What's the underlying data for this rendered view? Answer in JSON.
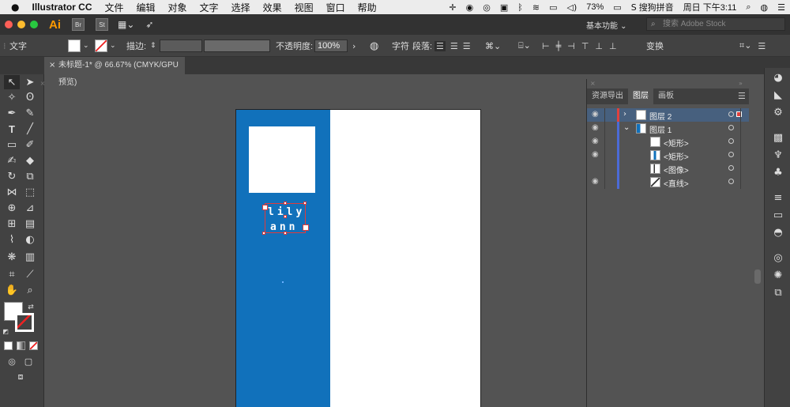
{
  "menubar": {
    "apple": "",
    "app_name": "Illustrator CC",
    "items": [
      "文件",
      "编辑",
      "对象",
      "文字",
      "选择",
      "效果",
      "视图",
      "窗口",
      "帮助"
    ],
    "battery": "73%",
    "input_method": "搜狗拼音",
    "clock": "周日 下午3:11"
  },
  "appbar": {
    "logo": "Ai",
    "bridge": "Br",
    "stock_app": "St",
    "workspace": "基本功能",
    "search_placeholder": "搜索 Adobe Stock"
  },
  "control": {
    "tool_label": "文字",
    "stroke_label": "描边:",
    "opacity_label": "不透明度:",
    "opacity_value": "100%",
    "char_label": "字符",
    "para_label": "段落:",
    "transform_label": "变换"
  },
  "document": {
    "tab_title": "未标题-1* @ 66.67% (CMYK/GPU 预览)"
  },
  "canvas": {
    "text_line1": "lily",
    "text_line2": "ann",
    "colors": {
      "blue": "#1171bb",
      "white": "#ffffff",
      "selection": "#e23a3a"
    }
  },
  "layers_panel": {
    "tabs": [
      "资源导出",
      "图层",
      "画板"
    ],
    "active_tab": "图层",
    "rows": [
      {
        "name": "图层 2",
        "expander": "›",
        "visible": true,
        "selected": true
      },
      {
        "name": "图层 1",
        "expander": "⌄",
        "visible": true,
        "selected": false
      },
      {
        "name": "<矩形>",
        "visible": true
      },
      {
        "name": "<矩形>",
        "visible": true
      },
      {
        "name": "<图像>",
        "visible": false
      },
      {
        "name": "<直线>",
        "visible": true
      }
    ]
  }
}
